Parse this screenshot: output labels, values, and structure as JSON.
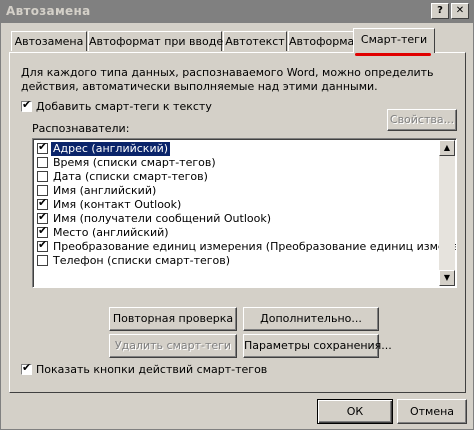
{
  "window": {
    "title": "Автозамена",
    "help_glyph": "?",
    "close_glyph": "✕"
  },
  "tabs": [
    {
      "label": "Автозамена"
    },
    {
      "label": "Автоформат при вводе"
    },
    {
      "label": "Автотекст"
    },
    {
      "label": "Автоформат"
    },
    {
      "label": "Смарт-теги",
      "active": true
    }
  ],
  "description": "Для каждого типа данных, распознаваемого Word, можно определить действия, автоматически выполняемые над этими данными.",
  "add_smart_tags": {
    "label": "Добавить смарт-теги к тексту",
    "checked": true
  },
  "properties_button": "Свойства...",
  "recognizers_label": "Распознаватели:",
  "recognizers": [
    {
      "label": "Адрес (английский)",
      "checked": true,
      "selected": true
    },
    {
      "label": "Время (списки смарт-тегов)",
      "checked": false
    },
    {
      "label": "Дата (списки смарт-тегов)",
      "checked": false
    },
    {
      "label": "Имя (английский)",
      "checked": false
    },
    {
      "label": "Имя (контакт Outlook)",
      "checked": true
    },
    {
      "label": "Имя (получатели сообщений Outlook)",
      "checked": true
    },
    {
      "label": "Место (английский)",
      "checked": true
    },
    {
      "label": "Преобразование единиц измерения (Преобразование единиц измерения)",
      "checked": true
    },
    {
      "label": "Телефон (списки смарт-тегов)",
      "checked": false
    }
  ],
  "buttons": {
    "recheck": "Повторная проверка",
    "more": "Дополнительно...",
    "remove": "Удалить смарт-теги",
    "save_options": "Параметры сохранения...",
    "ok": "ОК",
    "cancel": "Отмена"
  },
  "show_buttons": {
    "label": "Показать кнопки действий смарт-тегов",
    "checked": true
  },
  "check_glyph": "✔",
  "scroll_up_glyph": "▲",
  "scroll_down_glyph": "▼",
  "colors": {
    "selection": "#0a246a",
    "annotation": "#e00000",
    "face": "#d4d0c8"
  }
}
